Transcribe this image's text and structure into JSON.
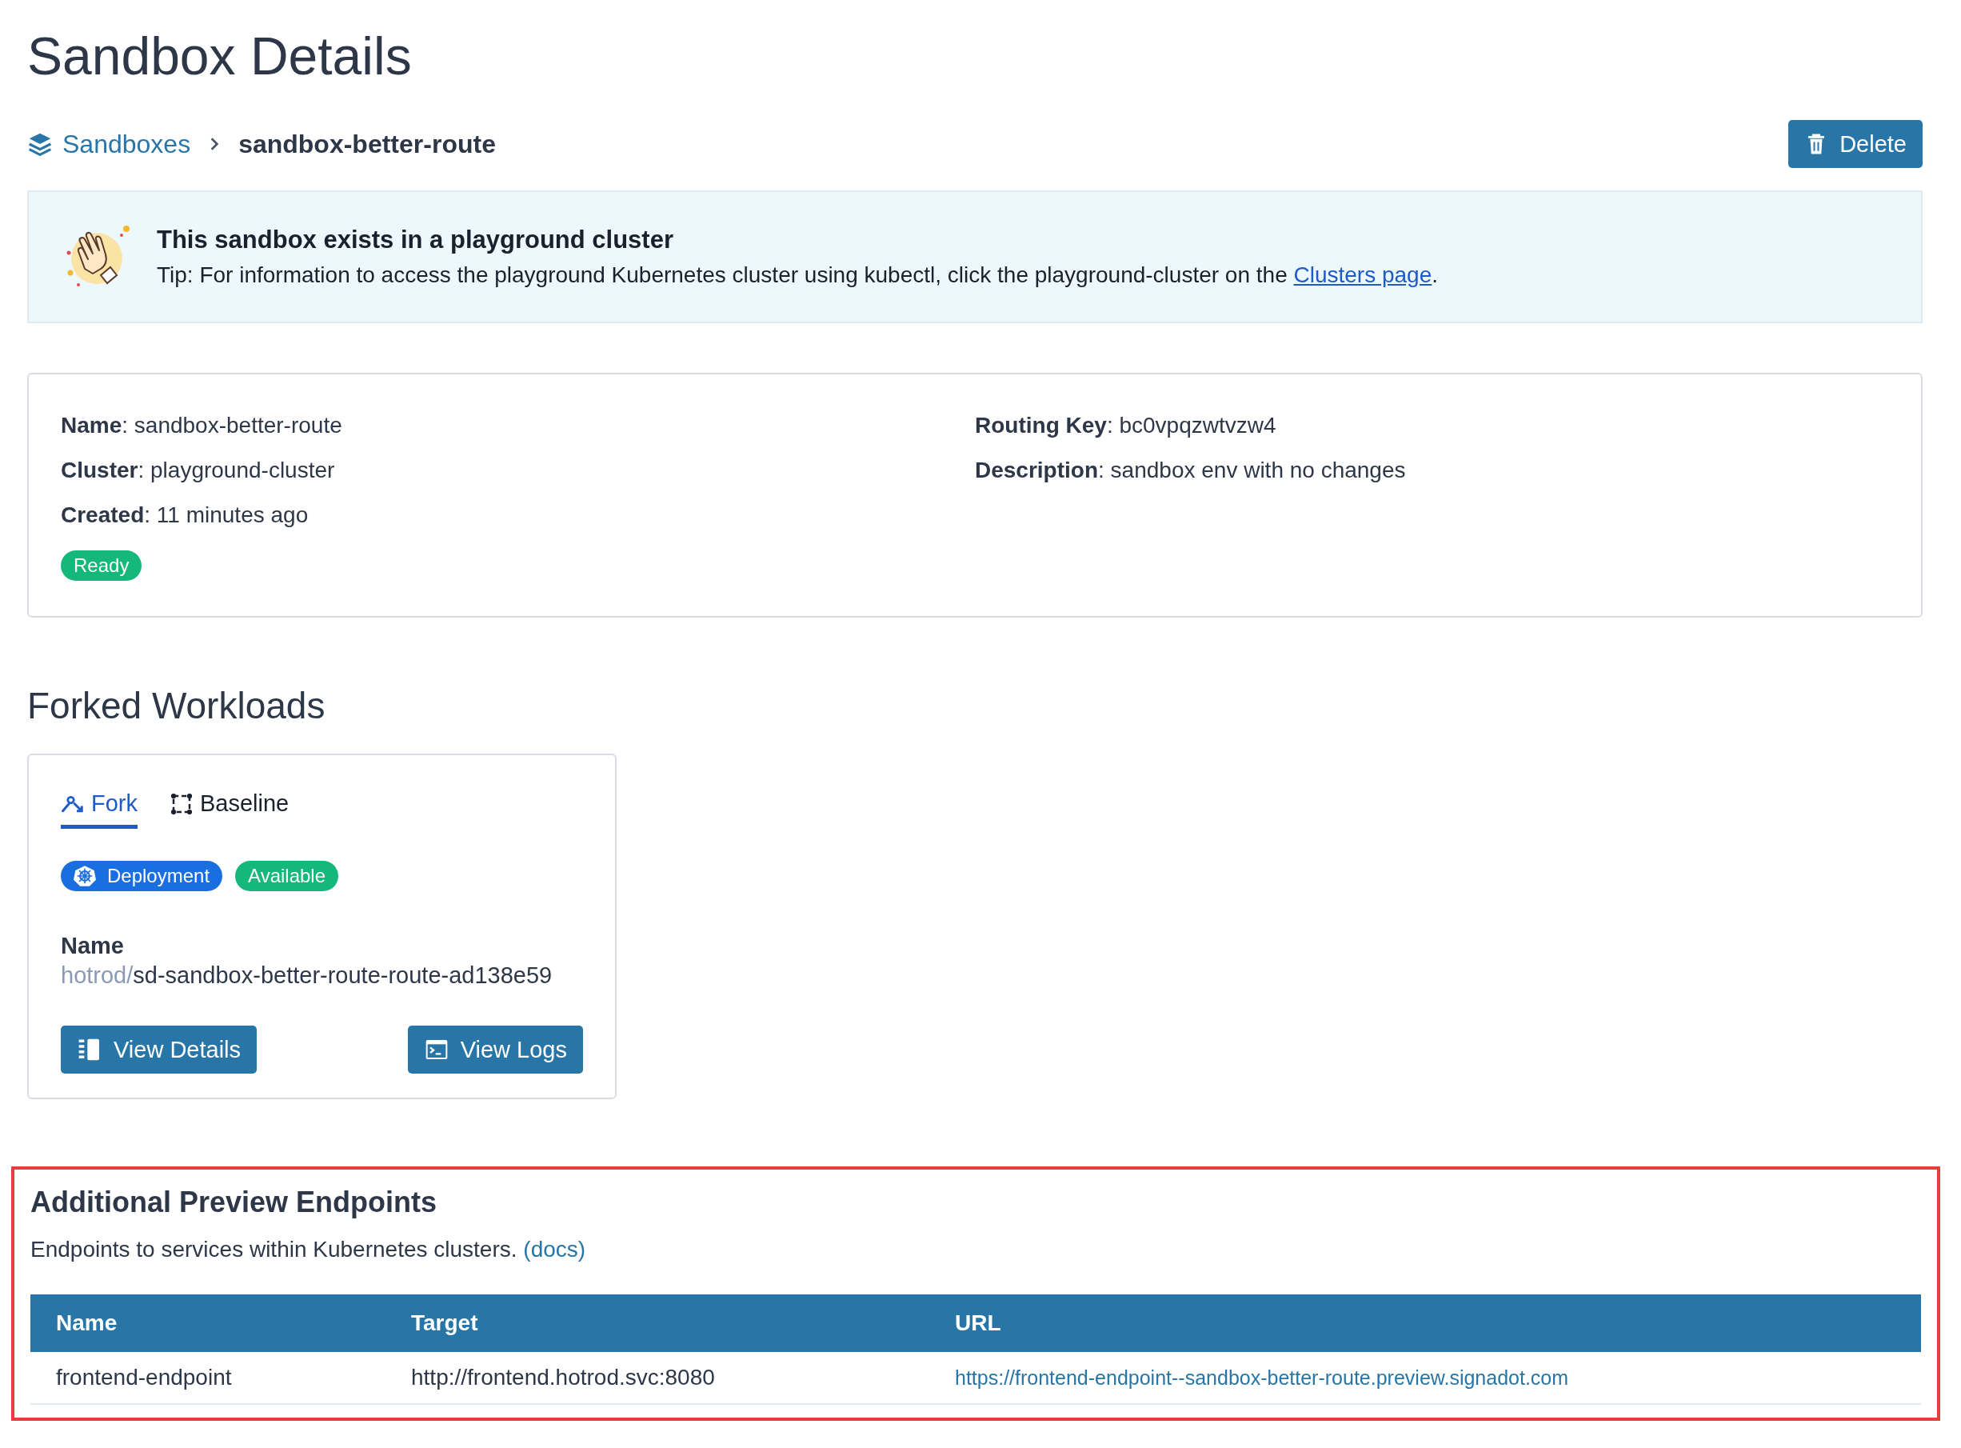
{
  "page": {
    "title": "Sandbox Details"
  },
  "breadcrumb": {
    "parent": "Sandboxes",
    "current": "sandbox-better-route"
  },
  "delete_button": {
    "label": "Delete"
  },
  "banner": {
    "title": "This sandbox exists in a playground cluster",
    "tip_before": "Tip: For information to access the playground Kubernetes cluster using kubectl, click the playground-cluster on the ",
    "tip_link": "Clusters page",
    "tip_after": "."
  },
  "details": {
    "left": [
      {
        "text": "**Name**: sandbox-better-route"
      },
      {
        "text": "**Cluster**: playground-cluster"
      },
      {
        "text": "**Created**: 11 minutes ago"
      }
    ],
    "right": [
      {
        "text": "**Routing Key**: bc0vpqzwtvzw4"
      },
      {
        "text": "**Description**: sandbox env with no changes"
      }
    ],
    "status": {
      "label": "Ready",
      "color": "#14b87a"
    }
  },
  "forked_workloads": {
    "title": "Forked Workloads",
    "tabs": [
      {
        "kind": "fork",
        "label": "Fork",
        "selected": true
      },
      {
        "kind": "baseline",
        "label": "Baseline",
        "selected": false
      }
    ],
    "badges": [
      {
        "kind": "kubernetes",
        "label": "Deployment",
        "color": "#1a6fe0"
      },
      {
        "kind": "status",
        "label": "Available",
        "color": "#14b87a"
      }
    ],
    "name_label": "Name",
    "namespace": "hotrod/",
    "name": "sd-sandbox-better-route-route-ad138e59",
    "buttons": [
      {
        "kind": "details",
        "label": "View Details"
      },
      {
        "kind": "logs",
        "label": "View Logs"
      }
    ]
  },
  "preview_endpoints": {
    "highlighted": true,
    "title": "Additional Preview Endpoints",
    "description": "Endpoints to services within Kubernetes clusters.",
    "docs_link": "(docs)",
    "table": {
      "columns": [
        "Name",
        "Target",
        "URL"
      ],
      "rows": [
        {
          "name": "frontend-endpoint",
          "target": "http://frontend.hotrod.svc:8080",
          "url": "https://frontend-endpoint--sandbox-better-route.preview.signadot.com"
        }
      ]
    }
  }
}
